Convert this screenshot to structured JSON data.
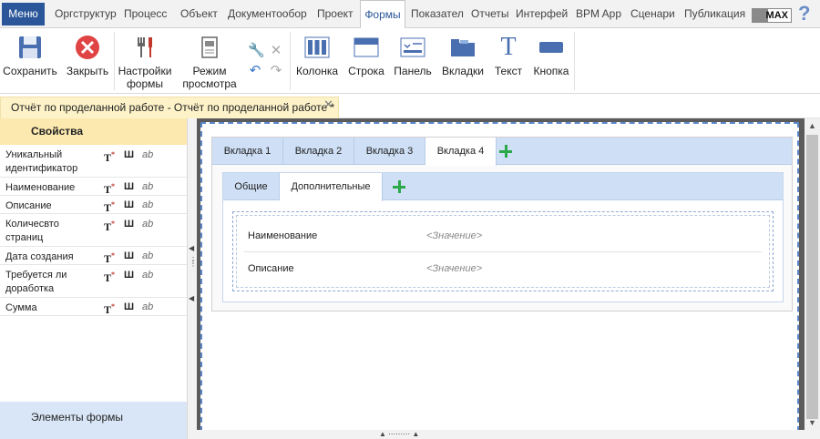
{
  "menubar": {
    "menu_label": "Меню",
    "tabs": [
      "Оргструктур",
      "Процесс",
      "Объект",
      "Документообор",
      "Проект",
      "Формы",
      "Показател",
      "Отчеты",
      "Интерфей",
      "BPM App",
      "Сценари",
      "Публикация"
    ],
    "active_tab": "Формы",
    "badge": "MAX"
  },
  "ribbon": {
    "save": "Сохранить",
    "close": "Закрыть",
    "form_settings_line1": "Настройки",
    "form_settings_line2": "формы",
    "view_mode_line1": "Режим",
    "view_mode_line2": "просмотра",
    "column": "Колонка",
    "row": "Строка",
    "panel": "Панель",
    "tabs": "Вкладки",
    "text": "Текст",
    "button": "Кнопка"
  },
  "document_tab": {
    "title": "Отчёт по проделанной работе - Отчёт по проделанной работе *"
  },
  "left_panel": {
    "header": "Свойства",
    "properties": [
      {
        "name": "Уникальный идентификатор",
        "t": "T",
        "c": "Ш",
        "ab": "ab"
      },
      {
        "name": "Наименование",
        "t": "T",
        "c": "Ш",
        "ab": "ab"
      },
      {
        "name": "Описание",
        "t": "T",
        "c": "Ш",
        "ab": "ab"
      },
      {
        "name": "Количесвто страниц",
        "t": "T",
        "c": "Ш",
        "ab": "ab"
      },
      {
        "name": "Дата создания",
        "t": "T",
        "c": "Ш",
        "ab": "ab"
      },
      {
        "name": "Требуется ли доработка",
        "t": "T",
        "c": "Ш",
        "ab": "ab"
      },
      {
        "name": "Сумма",
        "t": "T",
        "c": "Ш",
        "ab": "ab"
      }
    ],
    "footer": "Элементы формы"
  },
  "form": {
    "tabs": [
      "Вкладка 1",
      "Вкладка 2",
      "Вкладка 3",
      "Вкладка 4"
    ],
    "active_tab": "Вкладка 4",
    "subtabs": [
      "Общие",
      "Дополнительные"
    ],
    "active_subtab": "Дополнительные",
    "fields": [
      {
        "label": "Наименование",
        "value": "<Значение>"
      },
      {
        "label": "Описание",
        "value": "<Значение>"
      }
    ]
  },
  "colors": {
    "accent": "#2b579a",
    "doc_tab": "#fdf2c8",
    "props_header": "#fce9b0",
    "tab_bar": "#cfe0f6",
    "add_green": "#2aa84a"
  },
  "icons": [
    "save-icon",
    "close-icon",
    "form-settings-icon",
    "view-mode-icon",
    "undo-icon",
    "redo-icon",
    "column-icon",
    "row-icon",
    "panel-icon",
    "tabs-icon",
    "text-icon",
    "button-icon",
    "help-icon",
    "add-icon"
  ]
}
